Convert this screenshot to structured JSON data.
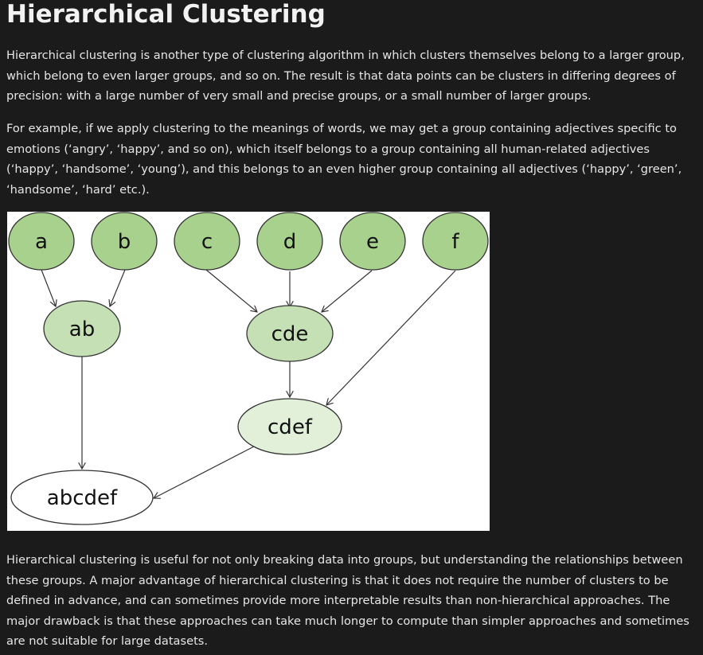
{
  "page": {
    "title": "Hierarchical Clustering",
    "paragraphs": [
      "Hierarchical clustering is another type of clustering algorithm in which clusters themselves belong to a larger group, which belong to even larger groups, and so on. The result is that data points can be clusters in differing degrees of precision: with a large number of very small and precise groups, or a small number of larger groups.",
      "For example, if we apply clustering to the meanings of words, we may get a group containing adjectives specific to emotions (‘angry’, ‘happy’, and so on), which itself belongs to a group containing all human-related adjectives (‘happy’, ‘handsome’, ‘young’), and this belongs to an even higher group containing all adjectives (‘happy’, ‘green’, ‘handsome’, ‘hard’ etc.).",
      "Hierarchical clustering is useful for not only breaking data into groups, but understanding the relationships between these groups. A major advantage of hierarchical clustering is that it does not require the number of clusters to be defined in advance, and can sometimes provide more interpretable results than non-hierarchical approaches. The major drawback is that these approaches can take much longer to compute than simpler approaches and sometimes are not suitable for large datasets."
    ]
  },
  "diagram": {
    "nodes": {
      "a": "a",
      "b": "b",
      "c": "c",
      "d": "d",
      "e": "e",
      "f": "f",
      "ab": "ab",
      "cde": "cde",
      "cdef": "cdef",
      "abcdef": "abcdef"
    },
    "colors": {
      "leaf": "#a8d18d",
      "level1": "#c5e0b4",
      "level2": "#e2f0d9",
      "root": "#ffffff",
      "stroke": "#333333"
    }
  }
}
